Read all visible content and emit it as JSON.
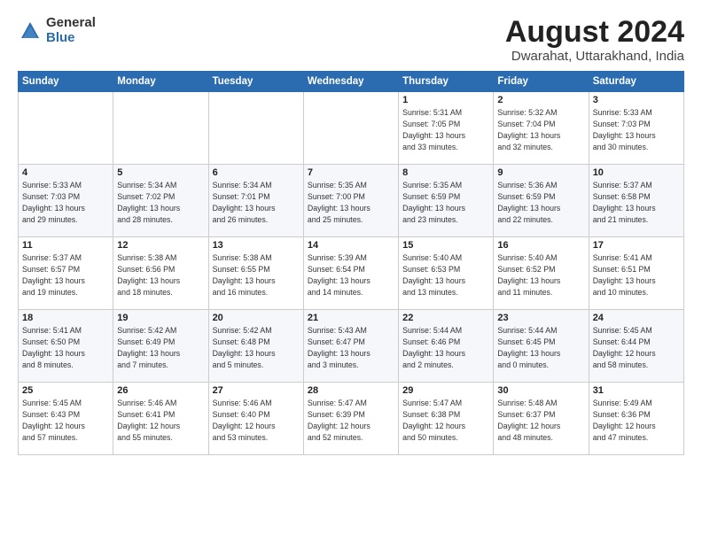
{
  "logo": {
    "general": "General",
    "blue": "Blue"
  },
  "title": "August 2024",
  "subtitle": "Dwarahat, Uttarakhand, India",
  "weekdays": [
    "Sunday",
    "Monday",
    "Tuesday",
    "Wednesday",
    "Thursday",
    "Friday",
    "Saturday"
  ],
  "weeks": [
    [
      {
        "day": "",
        "info": ""
      },
      {
        "day": "",
        "info": ""
      },
      {
        "day": "",
        "info": ""
      },
      {
        "day": "",
        "info": ""
      },
      {
        "day": "1",
        "info": "Sunrise: 5:31 AM\nSunset: 7:05 PM\nDaylight: 13 hours\nand 33 minutes."
      },
      {
        "day": "2",
        "info": "Sunrise: 5:32 AM\nSunset: 7:04 PM\nDaylight: 13 hours\nand 32 minutes."
      },
      {
        "day": "3",
        "info": "Sunrise: 5:33 AM\nSunset: 7:03 PM\nDaylight: 13 hours\nand 30 minutes."
      }
    ],
    [
      {
        "day": "4",
        "info": "Sunrise: 5:33 AM\nSunset: 7:03 PM\nDaylight: 13 hours\nand 29 minutes."
      },
      {
        "day": "5",
        "info": "Sunrise: 5:34 AM\nSunset: 7:02 PM\nDaylight: 13 hours\nand 28 minutes."
      },
      {
        "day": "6",
        "info": "Sunrise: 5:34 AM\nSunset: 7:01 PM\nDaylight: 13 hours\nand 26 minutes."
      },
      {
        "day": "7",
        "info": "Sunrise: 5:35 AM\nSunset: 7:00 PM\nDaylight: 13 hours\nand 25 minutes."
      },
      {
        "day": "8",
        "info": "Sunrise: 5:35 AM\nSunset: 6:59 PM\nDaylight: 13 hours\nand 23 minutes."
      },
      {
        "day": "9",
        "info": "Sunrise: 5:36 AM\nSunset: 6:59 PM\nDaylight: 13 hours\nand 22 minutes."
      },
      {
        "day": "10",
        "info": "Sunrise: 5:37 AM\nSunset: 6:58 PM\nDaylight: 13 hours\nand 21 minutes."
      }
    ],
    [
      {
        "day": "11",
        "info": "Sunrise: 5:37 AM\nSunset: 6:57 PM\nDaylight: 13 hours\nand 19 minutes."
      },
      {
        "day": "12",
        "info": "Sunrise: 5:38 AM\nSunset: 6:56 PM\nDaylight: 13 hours\nand 18 minutes."
      },
      {
        "day": "13",
        "info": "Sunrise: 5:38 AM\nSunset: 6:55 PM\nDaylight: 13 hours\nand 16 minutes."
      },
      {
        "day": "14",
        "info": "Sunrise: 5:39 AM\nSunset: 6:54 PM\nDaylight: 13 hours\nand 14 minutes."
      },
      {
        "day": "15",
        "info": "Sunrise: 5:40 AM\nSunset: 6:53 PM\nDaylight: 13 hours\nand 13 minutes."
      },
      {
        "day": "16",
        "info": "Sunrise: 5:40 AM\nSunset: 6:52 PM\nDaylight: 13 hours\nand 11 minutes."
      },
      {
        "day": "17",
        "info": "Sunrise: 5:41 AM\nSunset: 6:51 PM\nDaylight: 13 hours\nand 10 minutes."
      }
    ],
    [
      {
        "day": "18",
        "info": "Sunrise: 5:41 AM\nSunset: 6:50 PM\nDaylight: 13 hours\nand 8 minutes."
      },
      {
        "day": "19",
        "info": "Sunrise: 5:42 AM\nSunset: 6:49 PM\nDaylight: 13 hours\nand 7 minutes."
      },
      {
        "day": "20",
        "info": "Sunrise: 5:42 AM\nSunset: 6:48 PM\nDaylight: 13 hours\nand 5 minutes."
      },
      {
        "day": "21",
        "info": "Sunrise: 5:43 AM\nSunset: 6:47 PM\nDaylight: 13 hours\nand 3 minutes."
      },
      {
        "day": "22",
        "info": "Sunrise: 5:44 AM\nSunset: 6:46 PM\nDaylight: 13 hours\nand 2 minutes."
      },
      {
        "day": "23",
        "info": "Sunrise: 5:44 AM\nSunset: 6:45 PM\nDaylight: 13 hours\nand 0 minutes."
      },
      {
        "day": "24",
        "info": "Sunrise: 5:45 AM\nSunset: 6:44 PM\nDaylight: 12 hours\nand 58 minutes."
      }
    ],
    [
      {
        "day": "25",
        "info": "Sunrise: 5:45 AM\nSunset: 6:43 PM\nDaylight: 12 hours\nand 57 minutes."
      },
      {
        "day": "26",
        "info": "Sunrise: 5:46 AM\nSunset: 6:41 PM\nDaylight: 12 hours\nand 55 minutes."
      },
      {
        "day": "27",
        "info": "Sunrise: 5:46 AM\nSunset: 6:40 PM\nDaylight: 12 hours\nand 53 minutes."
      },
      {
        "day": "28",
        "info": "Sunrise: 5:47 AM\nSunset: 6:39 PM\nDaylight: 12 hours\nand 52 minutes."
      },
      {
        "day": "29",
        "info": "Sunrise: 5:47 AM\nSunset: 6:38 PM\nDaylight: 12 hours\nand 50 minutes."
      },
      {
        "day": "30",
        "info": "Sunrise: 5:48 AM\nSunset: 6:37 PM\nDaylight: 12 hours\nand 48 minutes."
      },
      {
        "day": "31",
        "info": "Sunrise: 5:49 AM\nSunset: 6:36 PM\nDaylight: 12 hours\nand 47 minutes."
      }
    ]
  ]
}
